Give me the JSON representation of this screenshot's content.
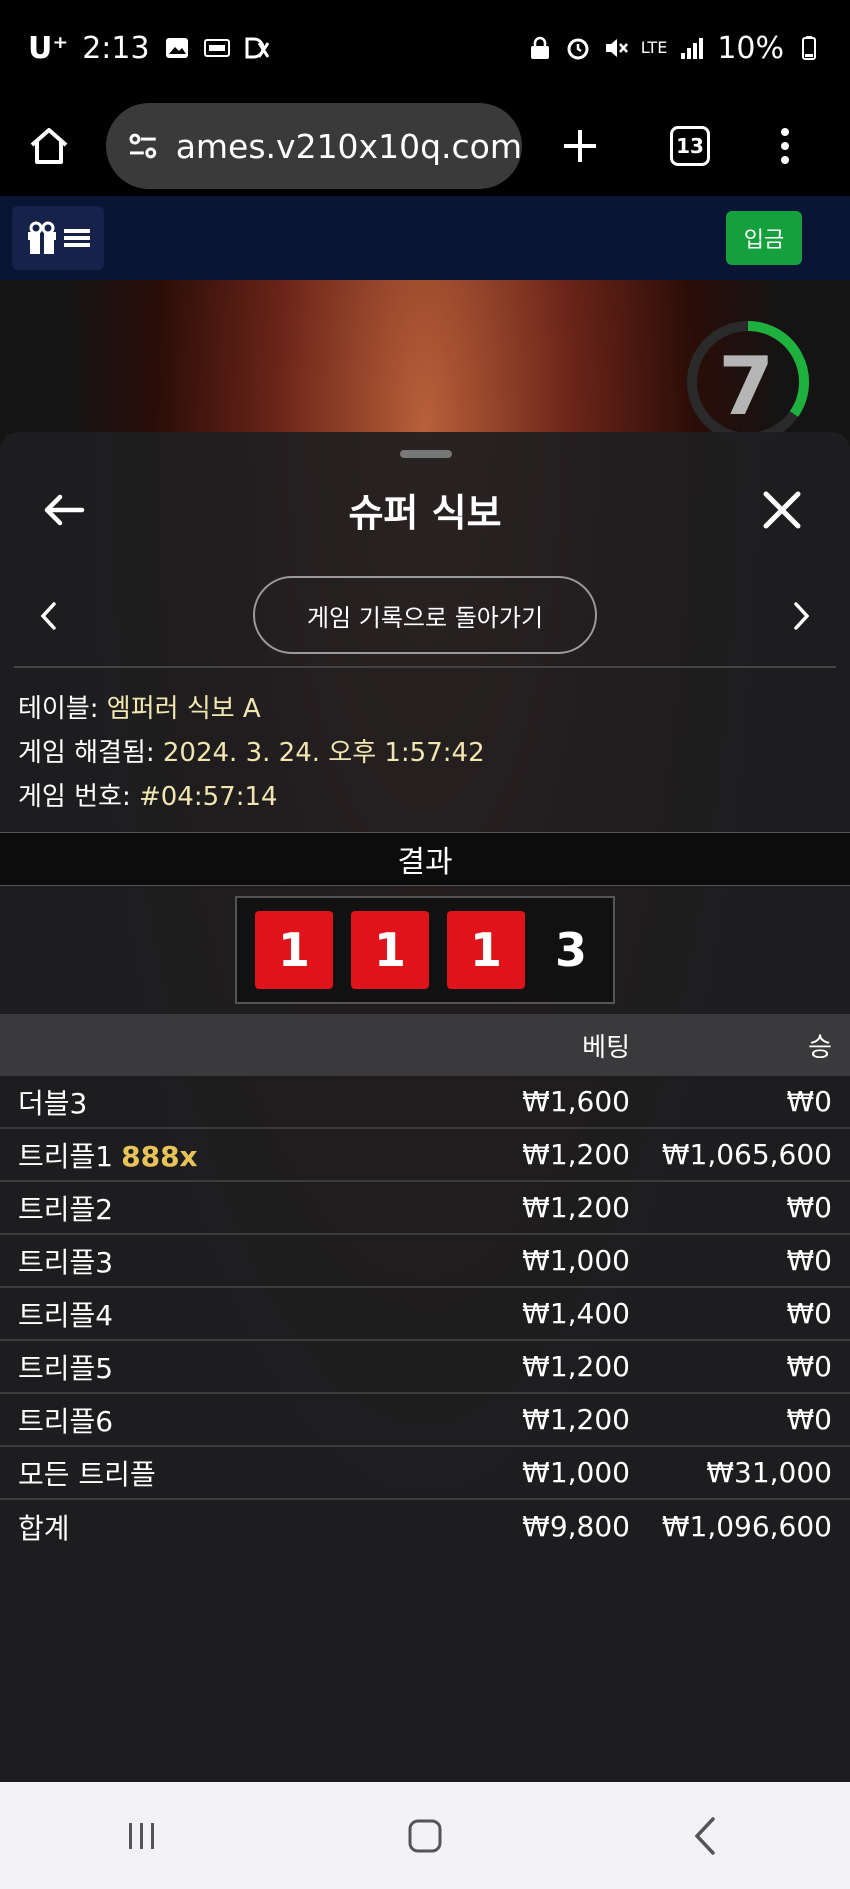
{
  "status_bar": {
    "carrier": "U⁺",
    "time": "2:13",
    "network": "LTE",
    "battery": "10%"
  },
  "browser": {
    "url": "ames.v210x10q.com",
    "tab_count": "13"
  },
  "site_header": {
    "deposit_label": "입금"
  },
  "game": {
    "timer_value": "7"
  },
  "sheet": {
    "title": "슈퍼 식보",
    "return_label": "게임 기록으로 돌아가기",
    "table_label": "테이블:",
    "table_value": "엠퍼러 식보 A",
    "resolved_label": "게임 해결됨:",
    "resolved_value": "2024. 3. 24. 오후 1:57:42",
    "game_no_label": "게임 번호:",
    "game_no_value": "#04:57:14",
    "result_label": "결과",
    "dice": [
      "1",
      "1",
      "1"
    ],
    "dice_total": "3",
    "col_bet": "베팅",
    "col_win": "승",
    "rows": [
      {
        "name": "더블3",
        "mult": "",
        "bet": "₩1,600",
        "win": "₩0"
      },
      {
        "name": "트리플1",
        "mult": "888x",
        "bet": "₩1,200",
        "win": "₩1,065,600"
      },
      {
        "name": "트리플2",
        "mult": "",
        "bet": "₩1,200",
        "win": "₩0"
      },
      {
        "name": "트리플3",
        "mult": "",
        "bet": "₩1,000",
        "win": "₩0"
      },
      {
        "name": "트리플4",
        "mult": "",
        "bet": "₩1,400",
        "win": "₩0"
      },
      {
        "name": "트리플5",
        "mult": "",
        "bet": "₩1,200",
        "win": "₩0"
      },
      {
        "name": "트리플6",
        "mult": "",
        "bet": "₩1,200",
        "win": "₩0"
      },
      {
        "name": "모든 트리플",
        "mult": "",
        "bet": "₩1,000",
        "win": "₩31,000"
      }
    ],
    "total": {
      "name": "합계",
      "bet": "₩9,800",
      "win": "₩1,096,600"
    }
  },
  "colors": {
    "die_red": "#e0121a",
    "deposit_green": "#14a03c",
    "multiplier_gold": "#e8c35a",
    "info_value": "#f0e6b0"
  }
}
